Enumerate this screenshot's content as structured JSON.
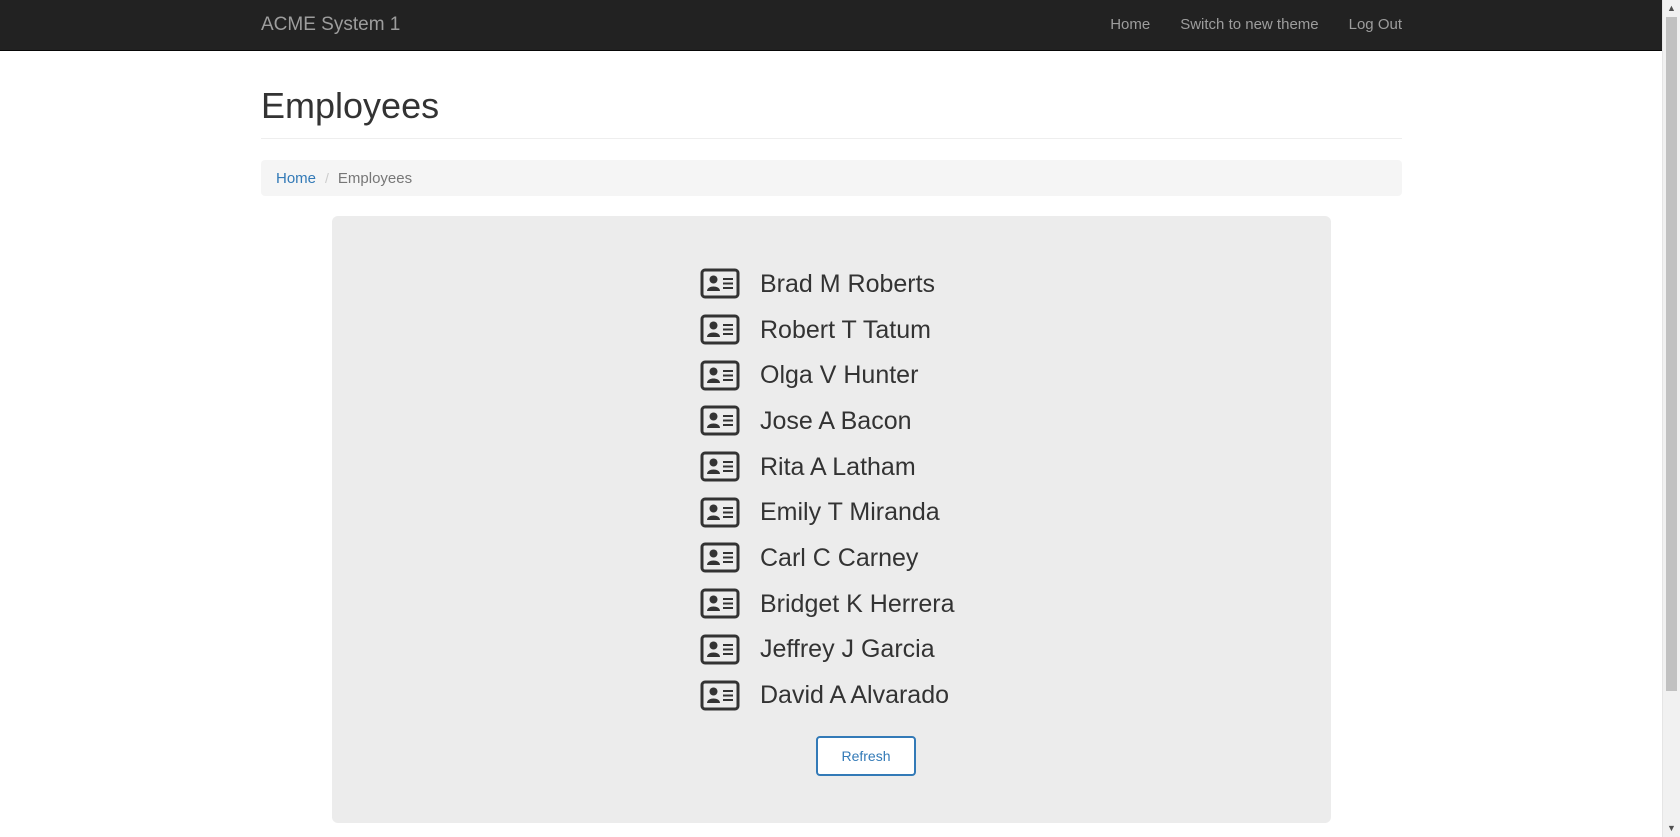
{
  "navbar": {
    "brand": "ACME System 1",
    "links": [
      "Home",
      "Switch to new theme",
      "Log Out"
    ]
  },
  "page": {
    "title": "Employees"
  },
  "breadcrumb": {
    "home": "Home",
    "separator": "/",
    "current": "Employees"
  },
  "employees": [
    "Brad M Roberts",
    "Robert T Tatum",
    "Olga V Hunter",
    "Jose A Bacon",
    "Rita A Latham",
    "Emily T Miranda",
    "Carl C Carney",
    "Bridget K Herrera",
    "Jeffrey J Garcia",
    "David A Alvarado"
  ],
  "employee_icon": "id-card-icon",
  "actions": {
    "refresh_label": "Refresh"
  },
  "colors": {
    "navbar_bg": "#222222",
    "link": "#337ab7",
    "panel_bg": "#ececec"
  }
}
